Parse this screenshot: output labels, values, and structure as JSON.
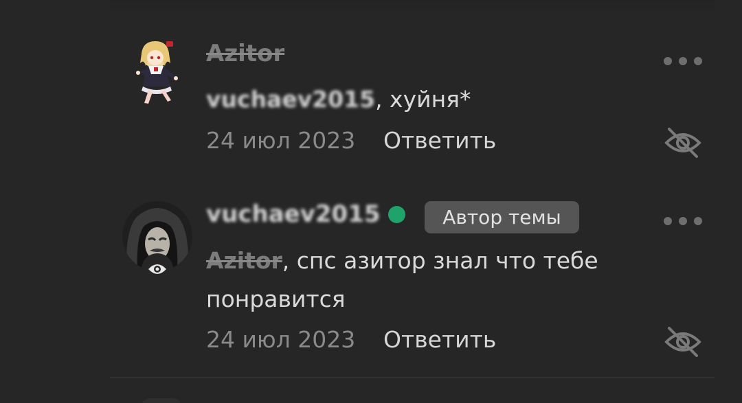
{
  "comments": [
    {
      "username": "Azitor",
      "text_mention": "vuchaev2015",
      "text_rest": ", хуйня*",
      "date": "24 июл 2023",
      "reply_label": "Ответить"
    },
    {
      "username": "vuchaev2015",
      "online": true,
      "badge": "Автор темы",
      "text_mention": "Azitor",
      "text_rest": ", спс азитор знал что тебе",
      "text_line2": "понравится",
      "date": "24 июл 2023",
      "reply_label": "Ответить"
    }
  ],
  "colors": {
    "background": "#262626",
    "online": "#1fa36a",
    "badge_bg": "#555555",
    "muted_text": "#8a8a8a",
    "primary_text": "#dadada"
  },
  "icons": {
    "more": "more-horizontal-icon",
    "hide": "eye-off-icon",
    "watch": "eye-icon"
  }
}
